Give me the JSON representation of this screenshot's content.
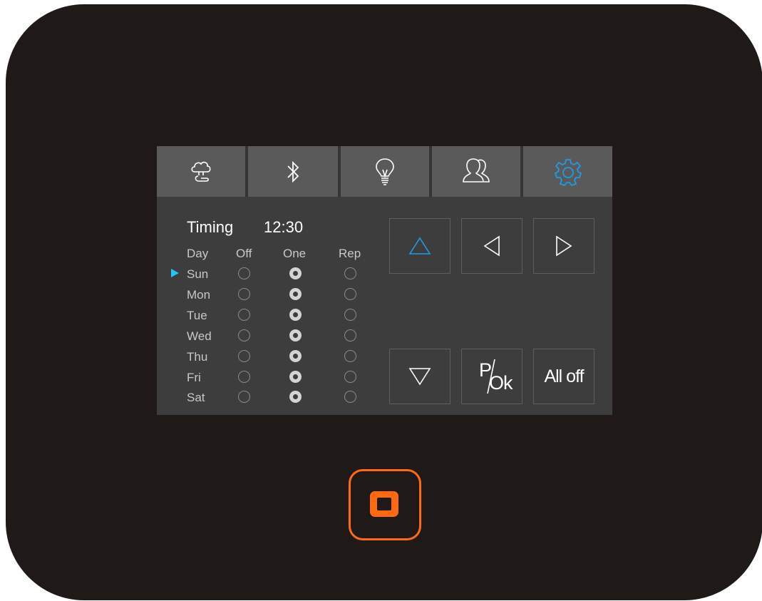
{
  "tabs": [
    {
      "icon": "cloud-tree-icon",
      "active": false
    },
    {
      "icon": "bluetooth-icon",
      "active": false
    },
    {
      "icon": "light-bulb-icon",
      "active": false
    },
    {
      "icon": "users-icon",
      "active": false
    },
    {
      "icon": "gear-icon",
      "active": true
    }
  ],
  "timing": {
    "title": "Timing",
    "time": "12:30",
    "headers": {
      "day": "Day",
      "off": "Off",
      "one": "One",
      "rep": "Rep"
    },
    "selected_day": "Sun",
    "days": [
      {
        "label": "Sun",
        "mode": "One"
      },
      {
        "label": "Mon",
        "mode": "One"
      },
      {
        "label": "Tue",
        "mode": "One"
      },
      {
        "label": "Wed",
        "mode": "One"
      },
      {
        "label": "Thu",
        "mode": "One"
      },
      {
        "label": "Fri",
        "mode": "One"
      },
      {
        "label": "Sat",
        "mode": "One"
      }
    ]
  },
  "controls": {
    "up_icon": "triangle-up-icon",
    "left_icon": "triangle-left-icon",
    "right_icon": "triangle-right-icon",
    "down_icon": "triangle-down-icon",
    "pok_p": "P",
    "pok_ok": "Ok",
    "all_off": "All off"
  },
  "home_icon": "home-square-icon",
  "colors": {
    "accent": "#1e9be6",
    "marker": "#1ec8ff",
    "home": "#ff6a10",
    "device": "#1f1a18",
    "screen": "#3e3d3d",
    "tab": "#5b5a5a"
  }
}
